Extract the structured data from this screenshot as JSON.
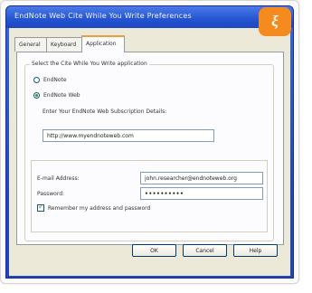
{
  "dialog": {
    "title": "EndNote Web Cite While You Write Preferences",
    "close_label": "×"
  },
  "badge": {
    "label": "ξ"
  },
  "tabs": [
    {
      "label": "General",
      "active": false
    },
    {
      "label": "Keyboard",
      "active": false
    },
    {
      "label": "Application",
      "active": true
    }
  ],
  "application": {
    "group_label": "Select the Cite While You Write application",
    "options": [
      {
        "label": "EndNote",
        "selected": false
      },
      {
        "label": "EndNote Web",
        "selected": true
      }
    ],
    "details_label": "Enter Your EndNote Web Subscription Details:",
    "url_value": "http://www.myendnoteweb.com",
    "email_label": "E-mail Address:",
    "email_value": "john.researcher@endnoteweb.org",
    "password_label": "Password:",
    "password_value": "••••••••••",
    "remember_label": "Remember my address and password",
    "remember_checked": true
  },
  "buttons": {
    "ok": "OK",
    "cancel": "Cancel",
    "help": "Help"
  },
  "colors": {
    "titlebar": "#2454d0",
    "dialog_body": "#ece9d8",
    "badge": "#f58a1f"
  }
}
